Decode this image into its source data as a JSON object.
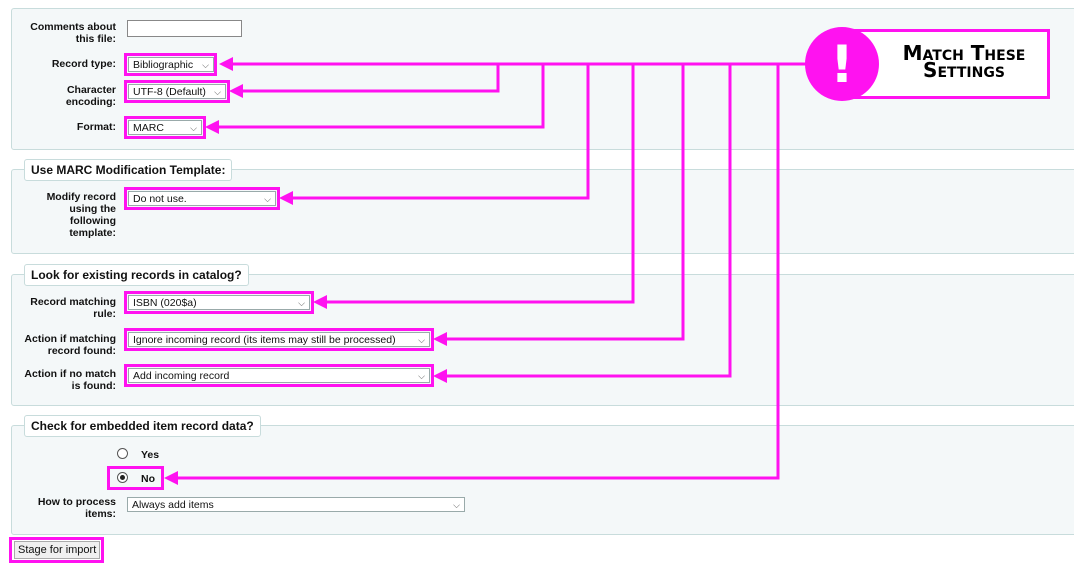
{
  "file_settings": {
    "comments_label": "Comments about this file:",
    "comments_value": "",
    "record_type_label": "Record type:",
    "record_type_value": "Bibliographic",
    "encoding_label": "Character encoding:",
    "encoding_value": "UTF-8 (Default)",
    "format_label": "Format:",
    "format_value": "MARC"
  },
  "modification": {
    "legend": "Use MARC Modification Template:",
    "template_label": "Modify record using the following template:",
    "template_value": "Do not use."
  },
  "matching": {
    "legend": "Look for existing records in catalog?",
    "rule_label": "Record matching rule:",
    "rule_value": "ISBN (020$a)",
    "action_match_label": "Action if matching record found:",
    "action_match_value": "Ignore incoming record (its items may still be processed)",
    "action_nomatch_label": "Action if no match is found:",
    "action_nomatch_value": "Add incoming record"
  },
  "items": {
    "legend": "Check for embedded item record data?",
    "yes_label": "Yes",
    "no_label": "No",
    "selected": "No",
    "process_label": "How to process items:",
    "process_value": "Always add items"
  },
  "actions": {
    "stage_button": "Stage for import"
  },
  "callout": {
    "text": "Match These Settings",
    "icon": "exclamation-icon"
  },
  "colors": {
    "highlight": "#ff12f0",
    "panel_bg": "#f4f8f9",
    "panel_border": "#c8dcdc"
  }
}
